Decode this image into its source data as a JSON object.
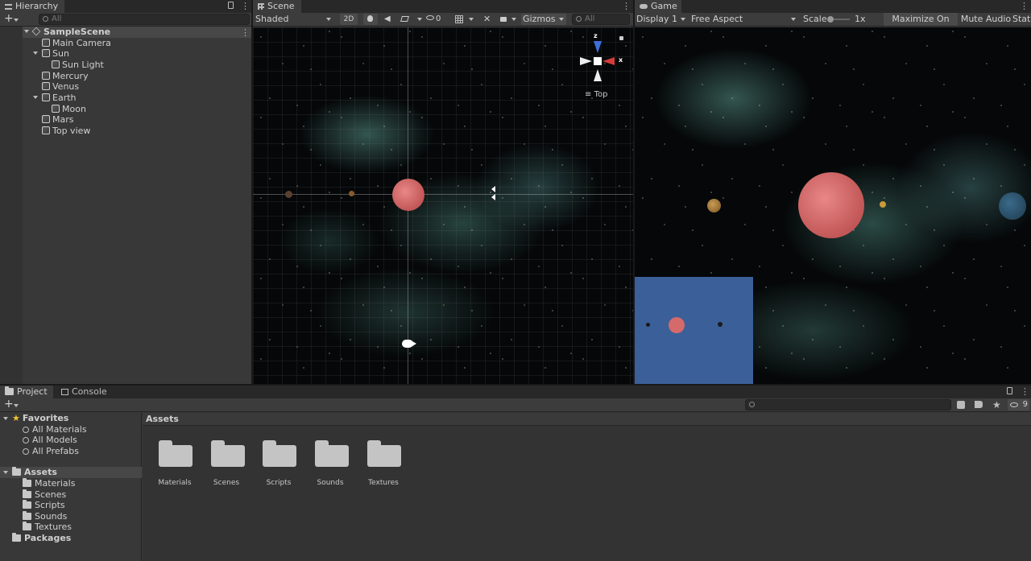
{
  "hierarchy": {
    "tab": "Hierarchy",
    "search_placeholder": "All",
    "scene": "SampleScene",
    "items": [
      {
        "label": "Main Camera",
        "indent": 1
      },
      {
        "label": "Sun",
        "indent": 1,
        "expanded": true
      },
      {
        "label": "Sun Light",
        "indent": 2
      },
      {
        "label": "Mercury",
        "indent": 1
      },
      {
        "label": "Venus",
        "indent": 1
      },
      {
        "label": "Earth",
        "indent": 1,
        "expanded": true
      },
      {
        "label": "Moon",
        "indent": 2
      },
      {
        "label": "Mars",
        "indent": 1
      },
      {
        "label": "Top view",
        "indent": 1
      }
    ]
  },
  "scene": {
    "tab": "Scene",
    "shading": "Shaded",
    "mode_2d": "2D",
    "hidden_count": "0",
    "gizmos": "Gizmos",
    "search_placeholder": "All",
    "gizmo_axis_z": "z",
    "gizmo_axis_x": "x",
    "view_label": "Top"
  },
  "game": {
    "tab": "Game",
    "display": "Display 1",
    "aspect": "Free Aspect",
    "scale_label": "Scale",
    "scale_value": "1x",
    "maximize": "Maximize On Play",
    "mute": "Mute Audio",
    "stats": "Stats"
  },
  "project": {
    "tab_project": "Project",
    "tab_console": "Console",
    "hidden_count": "9",
    "favorites_label": "Favorites",
    "favorites": [
      "All Materials",
      "All Models",
      "All Prefabs"
    ],
    "assets_label": "Assets",
    "asset_folders": [
      "Materials",
      "Scenes",
      "Scripts",
      "Sounds",
      "Textures"
    ],
    "packages_label": "Packages",
    "breadcrumb": "Assets",
    "grid_items": [
      "Materials",
      "Scenes",
      "Scripts",
      "Sounds",
      "Textures"
    ]
  },
  "colors": {
    "sun": "#d46a6a",
    "overlay": "#3b5f99"
  }
}
